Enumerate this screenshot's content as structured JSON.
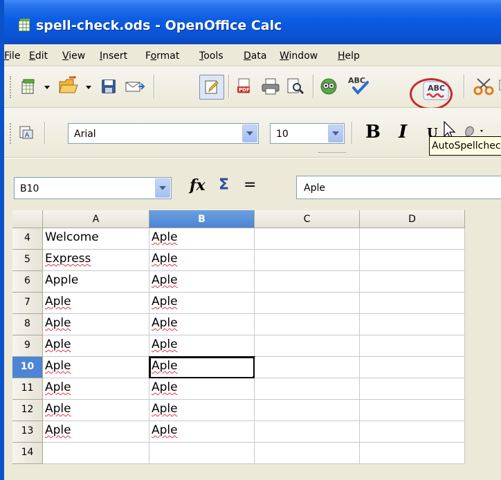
{
  "window": {
    "title": "spell-check.ods - OpenOffice Calc"
  },
  "menu": [
    "File",
    "Edit",
    "View",
    "Insert",
    "Format",
    "Tools",
    "Data",
    "Window",
    "Help"
  ],
  "menu_accels": [
    "F",
    "E",
    "V",
    "I",
    "o",
    "T",
    "D",
    "W",
    "H"
  ],
  "toolbar": {
    "spell_label": "ABC",
    "autospell_label": "ABC",
    "font_name": "Arial",
    "font_size": "10",
    "bold_label": "B",
    "italic_label": "I"
  },
  "tooltip": {
    "text": "AutoSpellcheck"
  },
  "formula_bar": {
    "name_box": "B10",
    "fx_label": "fx",
    "sigma_label": "Σ",
    "equals_label": "=",
    "input_value": "Aple"
  },
  "grid": {
    "columns": [
      "A",
      "B",
      "C",
      "D"
    ],
    "selected_column": "B",
    "selected_row": "10",
    "active_cell": "B10",
    "rows": [
      {
        "num": "4",
        "A": "Welcome",
        "B": "Aple",
        "A_miss": false,
        "B_miss": true
      },
      {
        "num": "5",
        "A": "Express",
        "B": "Aple",
        "A_miss": true,
        "B_miss": true
      },
      {
        "num": "6",
        "A": "Apple",
        "B": "Aple",
        "A_miss": false,
        "B_miss": true
      },
      {
        "num": "7",
        "A": "Aple",
        "B": "Aple",
        "A_miss": true,
        "B_miss": true
      },
      {
        "num": "8",
        "A": "Aple",
        "B": "Aple",
        "A_miss": true,
        "B_miss": true
      },
      {
        "num": "9",
        "A": "Aple",
        "B": "Aple",
        "A_miss": true,
        "B_miss": true
      },
      {
        "num": "10",
        "A": "Aple",
        "B": "Aple",
        "A_miss": true,
        "B_miss": true
      },
      {
        "num": "11",
        "A": "Aple",
        "B": "Aple",
        "A_miss": true,
        "B_miss": true
      },
      {
        "num": "12",
        "A": "Aple",
        "B": "Aple",
        "A_miss": true,
        "B_miss": true
      },
      {
        "num": "13",
        "A": "Aple",
        "B": "Aple",
        "A_miss": true,
        "B_miss": true
      },
      {
        "num": "14",
        "A": "",
        "B": "",
        "A_miss": false,
        "B_miss": false
      }
    ]
  },
  "colors": {
    "title_bar": "#0a5ce2",
    "selection": "#4d85d4",
    "misspell_underline": "#e8303a",
    "highlight_circle": "#c42a2a"
  }
}
